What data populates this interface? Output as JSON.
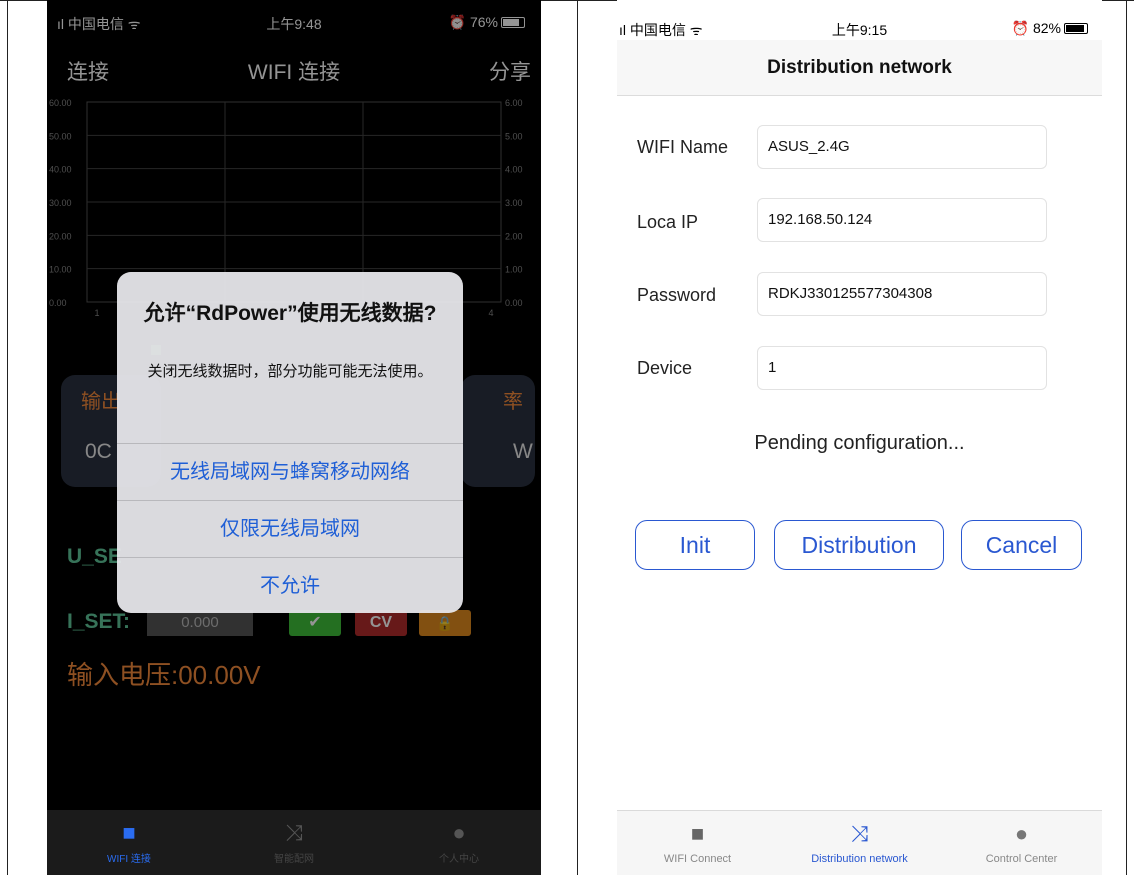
{
  "left": {
    "status": {
      "carrier": "ıl 中国电信 ᯤ",
      "time": "上午9:48",
      "battery": "76%"
    },
    "nav": {
      "left": "连接",
      "title": "WIFI 连接",
      "right": "分享"
    },
    "chart_data": {
      "type": "line",
      "y_left_ticks": [
        "60.00",
        "50.00",
        "40.00",
        "30.00",
        "20.00",
        "10.00",
        "0.00"
      ],
      "y_right_ticks": [
        "6.00",
        "5.00",
        "4.00",
        "3.00",
        "2.00",
        "1.00",
        "0.00"
      ],
      "x_ticks": [
        "1",
        "4"
      ],
      "ylim_left": [
        0,
        60
      ],
      "ylim_right": [
        0,
        6
      ],
      "grid": true,
      "series": []
    },
    "bg_text": {
      "output_partial": "输出",
      "rate_partial": "率",
      "out_value_partial": "0C",
      "power_partial": "W",
      "u_set_partial": "U_SE",
      "i_set_label": "I_SET:",
      "i_set_value": "0.000",
      "cv_label": "CV",
      "input_voltage": "输入电压:00.00V"
    },
    "alert": {
      "title": "允许“RdPower”使用无线数据?",
      "message": "关闭无线数据时，部分功能可能无法使用。",
      "option_wlan_cellular": "无线局域网与蜂窝移动网络",
      "option_wlan_only": "仅限无线局域网",
      "option_deny": "不允许"
    },
    "tabs": [
      {
        "label": "WIFI 连接",
        "icon": "cube-icon",
        "active": true
      },
      {
        "label": "智能配网",
        "icon": "shuffle-icon",
        "active": false
      },
      {
        "label": "个人中心",
        "icon": "person-icon",
        "active": false
      }
    ],
    "colors": {
      "accent": "#1f5fd6",
      "active_tab": "#2a6cf0"
    }
  },
  "right": {
    "status": {
      "carrier": "ıl 中国电信 ᯤ",
      "time": "上午9:15",
      "battery": "82%"
    },
    "title": "Distribution network",
    "fields": [
      {
        "label": "WIFI Name",
        "value": "ASUS_2.4G"
      },
      {
        "label": "Loca IP",
        "value": "192.168.50.124"
      },
      {
        "label": "Password",
        "value": "RDKJ330125577304308"
      },
      {
        "label": "Device",
        "value": "1"
      }
    ],
    "status_text": "Pending configuration...",
    "buttons": {
      "init": "Init",
      "distribution": "Distribution",
      "cancel": "Cancel"
    },
    "tabs": [
      {
        "label": "WIFI Connect",
        "icon": "cube-icon",
        "active": false
      },
      {
        "label": "Distribution network",
        "icon": "shuffle-icon",
        "active": true
      },
      {
        "label": "Control Center",
        "icon": "person-icon",
        "active": false
      }
    ],
    "colors": {
      "accent": "#2a58d1"
    }
  }
}
